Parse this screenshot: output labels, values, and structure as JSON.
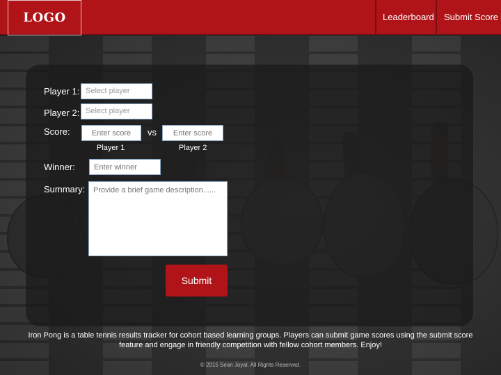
{
  "header": {
    "logo_text": "LOGO",
    "nav": [
      {
        "label": "Leaderboard"
      },
      {
        "label": "Submit Score"
      }
    ]
  },
  "form": {
    "player1_label": "Player 1:",
    "player1_placeholder": "Select player",
    "player2_label": "Player 2:",
    "player2_placeholder": "Select player",
    "score_label": "Score:",
    "score1_placeholder": "Enter score",
    "score2_placeholder": "Enter score",
    "vs_label": "vs",
    "score1_sublabel": "Player 1",
    "score2_sublabel": "Player 2",
    "winner_label": "Winner:",
    "winner_placeholder": "Enter winner",
    "summary_label": "Summary:",
    "summary_placeholder": "Provide a brief game description......",
    "submit_label": "Submit"
  },
  "footer": {
    "description": "Iron Pong is a table tennis results tracker for cohort based learning groups. Players can submit game scores using the submit score feature and engage in friendly competition with fellow cohort members. Enjoy!",
    "copyright": "© 2015 Sean Joyal. All Rights Reserved."
  },
  "colors": {
    "brand_red": "#b01418",
    "panel": "#191919"
  }
}
